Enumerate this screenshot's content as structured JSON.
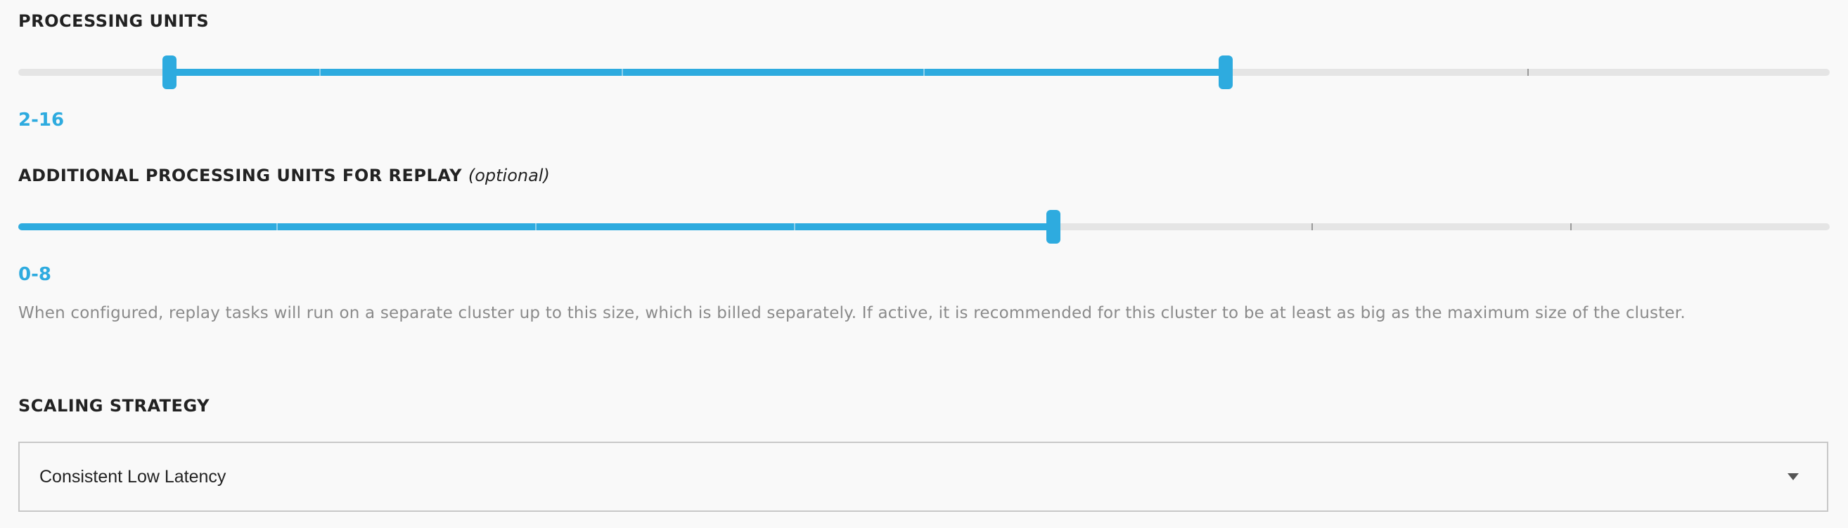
{
  "processing_units": {
    "title": "PROCESSING UNITS",
    "range_text": "2-16",
    "slider": {
      "min": 0,
      "max": 24,
      "low": 2,
      "high": 16,
      "step_marks": [
        0,
        4,
        8,
        12,
        16,
        20,
        24
      ],
      "fill_color": "#2eabdf",
      "track_color": "#e5e5e5"
    }
  },
  "replay_units": {
    "title": "ADDITIONAL PROCESSING UNITS FOR REPLAY",
    "title_suffix": "(optional)",
    "range_text": "0-8",
    "slider": {
      "min": 0,
      "max": 14,
      "low": 0,
      "high": 8,
      "step_marks": [
        0,
        2,
        4,
        6,
        8,
        10,
        12,
        14
      ],
      "fill_color": "#2eabdf",
      "track_color": "#e5e5e5"
    },
    "help_text": "When configured, replay tasks will run on a separate cluster up to this size, which is billed separately. If active, it is recommended for this cluster to be at least as big as the maximum size of the cluster."
  },
  "scaling_strategy": {
    "title": "SCALING STRATEGY",
    "selected": "Consistent Low Latency",
    "icon": "chevron-down-icon"
  }
}
